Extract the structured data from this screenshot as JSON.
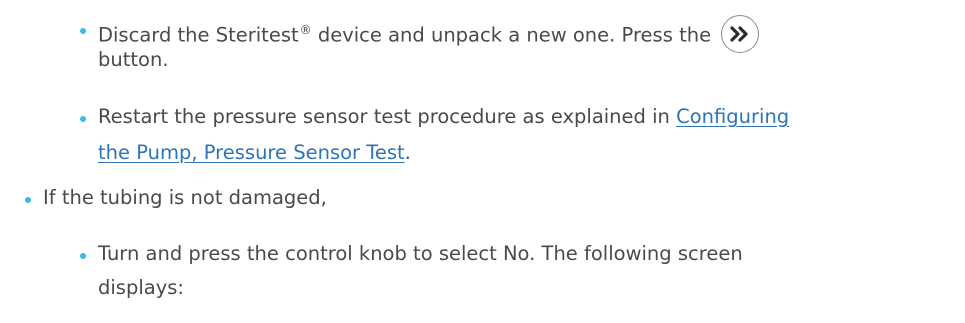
{
  "items": [
    {
      "text_before_mark": "Discard the Steritest",
      "mark": "®",
      "text_after_mark": " device and unpack a new one. Press the",
      "continuation": "button.",
      "button_icon": "double-chevron-right-icon"
    },
    {
      "text": "Restart the pressure sensor test procedure as explained in",
      "link_line1": "Configuring",
      "link_line2": "the Pump, Pressure Sensor Test",
      "trailing": "."
    },
    {
      "text": "If the tubing is not damaged,"
    },
    {
      "text": "Turn and press the control knob to select No. The following screen",
      "continuation": "displays:"
    }
  ],
  "colors": {
    "bullet": "#39b9e8",
    "link": "#2f74b5",
    "text": "#4a4a4a"
  }
}
